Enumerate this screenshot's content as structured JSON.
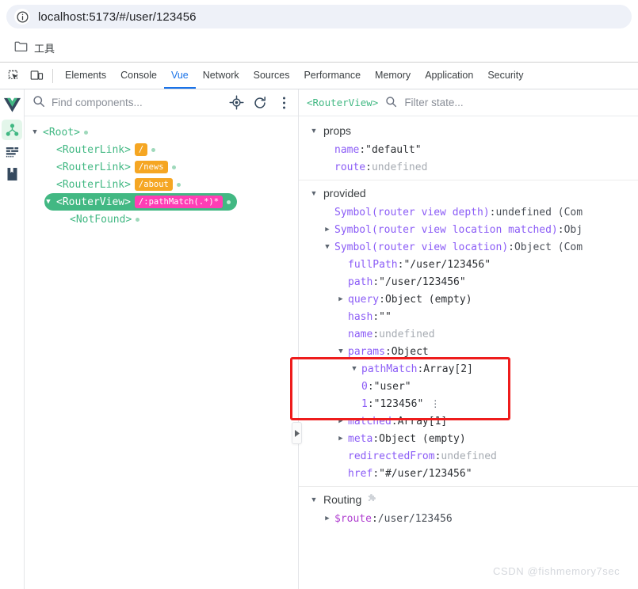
{
  "browser": {
    "url": "localhost:5173/#/user/123456",
    "info_icon": "info-circle-icon",
    "bookmarks": [
      {
        "icon": "folder-icon",
        "label": "工具"
      }
    ]
  },
  "devtools": {
    "inspect_icon": "inspect-element-icon",
    "device_icon": "device-toolbar-icon",
    "tabs": [
      {
        "label": "Elements",
        "active": false
      },
      {
        "label": "Console",
        "active": false
      },
      {
        "label": "Vue",
        "active": true
      },
      {
        "label": "Network",
        "active": false
      },
      {
        "label": "Sources",
        "active": false
      },
      {
        "label": "Performance",
        "active": false
      },
      {
        "label": "Memory",
        "active": false
      },
      {
        "label": "Application",
        "active": false
      },
      {
        "label": "Security",
        "active": false
      }
    ],
    "active_tab_color": "#1a73e8"
  },
  "vue_devtools": {
    "rail": [
      {
        "name": "vue-logo-icon",
        "active": false
      },
      {
        "name": "component-tree-icon",
        "active": true
      },
      {
        "name": "timeline-icon",
        "active": false
      },
      {
        "name": "docs-book-icon",
        "active": false
      }
    ],
    "tree_toolbar": {
      "search_icon": "search-icon",
      "search_placeholder": "Find components...",
      "select_icon": "target-select-icon",
      "refresh_icon": "refresh-icon",
      "more_icon": "more-vertical-icon"
    },
    "component_tree": [
      {
        "indent": 0,
        "arrow": "down",
        "tag": "<Root>",
        "badge": "",
        "selected": false
      },
      {
        "indent": 1,
        "arrow": "none",
        "tag": "<RouterLink>",
        "badge": "/",
        "selected": false
      },
      {
        "indent": 1,
        "arrow": "none",
        "tag": "<RouterLink>",
        "badge": "/news",
        "selected": false
      },
      {
        "indent": 1,
        "arrow": "none",
        "tag": "<RouterLink>",
        "badge": "/about",
        "selected": false
      },
      {
        "indent": 1,
        "arrow": "down",
        "tag": "<RouterView>",
        "badge": "/:pathMatch(.*)*",
        "selected": true
      },
      {
        "indent": 2,
        "arrow": "none",
        "tag": "<NotFound>",
        "badge": "",
        "selected": false
      }
    ],
    "selected_badge_color": "#ff3eb5",
    "badge_color": "#f5a623",
    "selected_row_color": "#42b883",
    "state_toolbar": {
      "component_tag": "<RouterView>",
      "search_icon": "search-icon",
      "filter_placeholder": "Filter state..."
    },
    "sections": [
      {
        "title": "props",
        "rows": [
          {
            "indent": 1,
            "arrow": "none",
            "key": "name",
            "key_kind": "normal",
            "sep": ": ",
            "value": "\"default\"",
            "value_kind": "str"
          },
          {
            "indent": 1,
            "arrow": "none",
            "key": "route",
            "key_kind": "normal",
            "sep": ": ",
            "value": "undefined",
            "value_kind": "undef"
          }
        ]
      },
      {
        "title": "provided",
        "rows": [
          {
            "indent": 1,
            "arrow": "none",
            "key": "Symbol(router view depth)",
            "key_kind": "sym",
            "sep": ": ",
            "value": "undefined (Com",
            "value_kind": "plain"
          },
          {
            "indent": 1,
            "arrow": "right",
            "key": "Symbol(router view location matched)",
            "key_kind": "sym",
            "sep": ": ",
            "value": "Obj",
            "value_kind": "plain"
          },
          {
            "indent": 1,
            "arrow": "down",
            "key": "Symbol(router view location)",
            "key_kind": "sym",
            "sep": ": ",
            "value": "Object (Com",
            "value_kind": "plain"
          },
          {
            "indent": 2,
            "arrow": "none",
            "key": "fullPath",
            "key_kind": "normal",
            "sep": ": ",
            "value": "\"/user/123456\"",
            "value_kind": "str"
          },
          {
            "indent": 2,
            "arrow": "none",
            "key": "path",
            "key_kind": "normal",
            "sep": ": ",
            "value": "\"/user/123456\"",
            "value_kind": "str"
          },
          {
            "indent": 2,
            "arrow": "right",
            "key": "query",
            "key_kind": "normal",
            "sep": ": ",
            "value": "Object (empty)",
            "value_kind": "obj"
          },
          {
            "indent": 2,
            "arrow": "none",
            "key": "hash",
            "key_kind": "normal",
            "sep": ": ",
            "value": "\"\"",
            "value_kind": "str"
          },
          {
            "indent": 2,
            "arrow": "none",
            "key": "name",
            "key_kind": "normal",
            "sep": ": ",
            "value": "undefined",
            "value_kind": "undef"
          },
          {
            "indent": 2,
            "arrow": "down",
            "key": "params",
            "key_kind": "normal",
            "sep": ": ",
            "value": "Object",
            "value_kind": "obj"
          },
          {
            "indent": 3,
            "arrow": "down",
            "key": "pathMatch",
            "key_kind": "normal",
            "sep": ": ",
            "value": "Array[2]",
            "value_kind": "obj"
          },
          {
            "indent": 4,
            "arrow": "none",
            "key": "0",
            "key_kind": "normal",
            "sep": ": ",
            "value": "\"user\"",
            "value_kind": "str"
          },
          {
            "indent": 4,
            "arrow": "none",
            "key": "1",
            "key_kind": "normal",
            "sep": ": ",
            "value": "\"123456\"",
            "value_kind": "str",
            "kebab": "⋮"
          },
          {
            "indent": 2,
            "arrow": "right",
            "key": "matched",
            "key_kind": "normal",
            "sep": ": ",
            "value": "Array[1]",
            "value_kind": "obj"
          },
          {
            "indent": 2,
            "arrow": "right",
            "key": "meta",
            "key_kind": "normal",
            "sep": ": ",
            "value": "Object (empty)",
            "value_kind": "obj"
          },
          {
            "indent": 2,
            "arrow": "none",
            "key": "redirectedFrom",
            "key_kind": "normal",
            "sep": ": ",
            "value": "undefined",
            "value_kind": "undef"
          },
          {
            "indent": 2,
            "arrow": "none",
            "key": "href",
            "key_kind": "normal",
            "sep": ": ",
            "value": "\"#/user/123456\"",
            "value_kind": "str"
          }
        ]
      },
      {
        "title": "Routing",
        "icon": "puzzle-piece-icon",
        "rows": [
          {
            "indent": 1,
            "arrow": "right",
            "key": "$route",
            "key_kind": "dollar",
            "sep": ": ",
            "value": "/user/123456",
            "value_kind": "plain"
          }
        ]
      }
    ],
    "annotation": {
      "name": "red-highlight-box",
      "color": "#ee1c1c"
    },
    "watermark": "CSDN @fishmemory7sec"
  }
}
